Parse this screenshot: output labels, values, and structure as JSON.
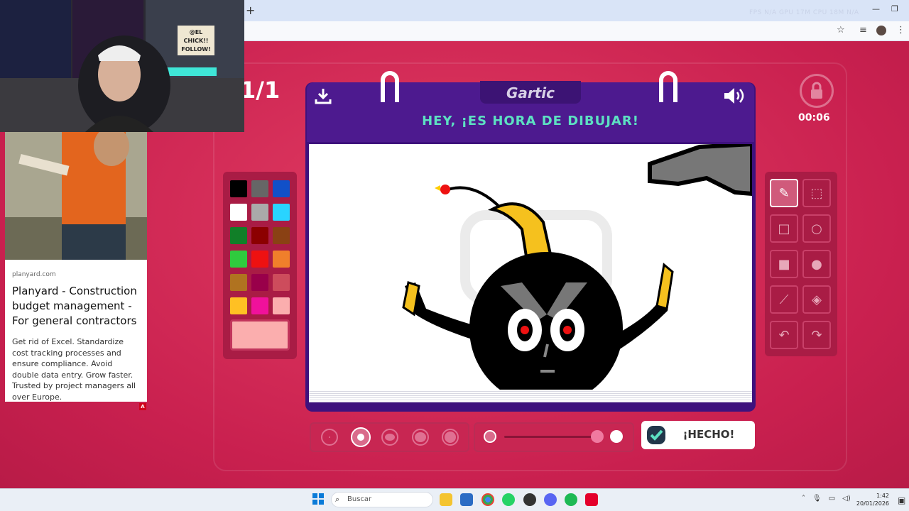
{
  "browser": {
    "new_tab_symbol": "+",
    "stats": "FPS N/A   GPU 17M   CPU 18M   N/A",
    "window_controls": [
      "—",
      "❐",
      "✕"
    ],
    "addr_icons": [
      "star-icon",
      "reading-list-icon",
      "profile-avatar",
      "menu-dots-icon"
    ]
  },
  "webcam": {
    "sign_text": "@EL CHICK!! FOLLOW!"
  },
  "ad": {
    "domain": "planyard.com",
    "title": "Planyard - Construction budget management - For general contractors",
    "body": "Get rid of Excel. Standardize cost tracking processes and ensure compliance. Avoid double data entry. Grow faster. Trusted by project managers all over Europe.",
    "badge": "A"
  },
  "game": {
    "logo": "Gartic",
    "headline": "HEY, ¡ES HORA DE DIBUJAR!",
    "round": "1/1",
    "timer": "00:06",
    "done_label": "¡HECHO!",
    "palette": [
      "#000000",
      "#666666",
      "#1150c8",
      "#ffffff",
      "#aaaaaa",
      "#29d4ff",
      "#117f28",
      "#8c0000",
      "#8a4114",
      "#2fcb3e",
      "#ee1111",
      "#f07f2b",
      "#b07320",
      "#99004a",
      "#cd4c5c",
      "#ffc023",
      "#f0119b",
      "#fbaeae"
    ],
    "selected_color": "#fbaeae",
    "tools": [
      {
        "name": "pencil",
        "active": true
      },
      {
        "name": "eraser",
        "active": false
      },
      {
        "name": "rectangle-outline",
        "active": false
      },
      {
        "name": "circle-outline",
        "active": false
      },
      {
        "name": "rectangle-filled",
        "active": false
      },
      {
        "name": "circle-filled",
        "active": false
      },
      {
        "name": "line",
        "active": false
      },
      {
        "name": "fill-bucket",
        "active": false
      },
      {
        "name": "undo",
        "active": false
      },
      {
        "name": "redo",
        "active": false
      }
    ],
    "brush_sizes": 5,
    "selected_brush_size": 2,
    "opacity": 0.94
  },
  "taskbar": {
    "search_placeholder": "Buscar",
    "time": "1:42",
    "date": "20/01/2026"
  }
}
